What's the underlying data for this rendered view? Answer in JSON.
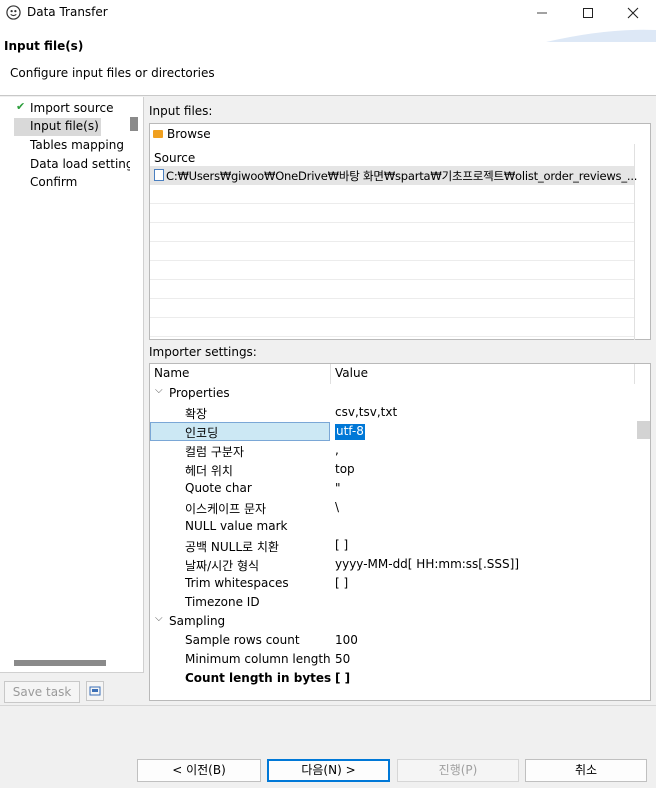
{
  "window": {
    "title": "Data Transfer",
    "icons": {
      "app": "dbeaver-icon",
      "minimize": "minimize-icon",
      "maximize": "maximize-icon",
      "close": "close-icon"
    }
  },
  "header": {
    "title": "Input file(s)",
    "subtitle": "Configure input files or directories"
  },
  "nav": {
    "items": [
      {
        "label": "Import source",
        "done": true
      },
      {
        "label": "Input file(s)",
        "selected": true
      },
      {
        "label": "Tables mapping"
      },
      {
        "label": "Data load settings"
      },
      {
        "label": "Confirm"
      }
    ],
    "save_task": "Save task"
  },
  "input_files": {
    "label": "Input files:",
    "browse": "Browse",
    "column": "Source",
    "rows": [
      "C:₩Users₩giwoo₩OneDrive₩바탕 화면₩sparta₩기초프로젝트₩olist_order_reviews_..."
    ]
  },
  "importer": {
    "label": "Importer settings:",
    "columns": {
      "name": "Name",
      "value": "Value"
    },
    "groups": [
      {
        "name": "Properties",
        "rows": [
          {
            "name": "확장",
            "value": "csv,tsv,txt"
          },
          {
            "name": "인코딩",
            "value": "utf-8",
            "selected": true
          },
          {
            "name": "컬럼 구분자",
            "value": ","
          },
          {
            "name": "헤더 위치",
            "value": "top"
          },
          {
            "name": "Quote char",
            "value": "\""
          },
          {
            "name": "이스케이프 문자",
            "value": "\\"
          },
          {
            "name": "NULL value mark",
            "value": ""
          },
          {
            "name": "공백 NULL로 치환",
            "value": "[ ]"
          },
          {
            "name": "날짜/시간 형식",
            "value": "yyyy-MM-dd[ HH:mm:ss[.SSS]]"
          },
          {
            "name": "Trim whitespaces",
            "value": "[ ]"
          },
          {
            "name": "Timezone ID",
            "value": ""
          }
        ]
      },
      {
        "name": "Sampling",
        "rows": [
          {
            "name": "Sample rows count",
            "value": "100"
          },
          {
            "name": "Minimum column length",
            "value": "50"
          },
          {
            "name": "Count length in bytes",
            "value": "[ ]",
            "bold": true
          }
        ]
      }
    ]
  },
  "footer": {
    "prev": "< 이전(B)",
    "next": "다음(N) >",
    "run": "진행(P)",
    "cancel": "취소"
  },
  "colors": {
    "selection": "#0078d7",
    "check": "#2a9d3a",
    "folder": "#f0a020"
  }
}
